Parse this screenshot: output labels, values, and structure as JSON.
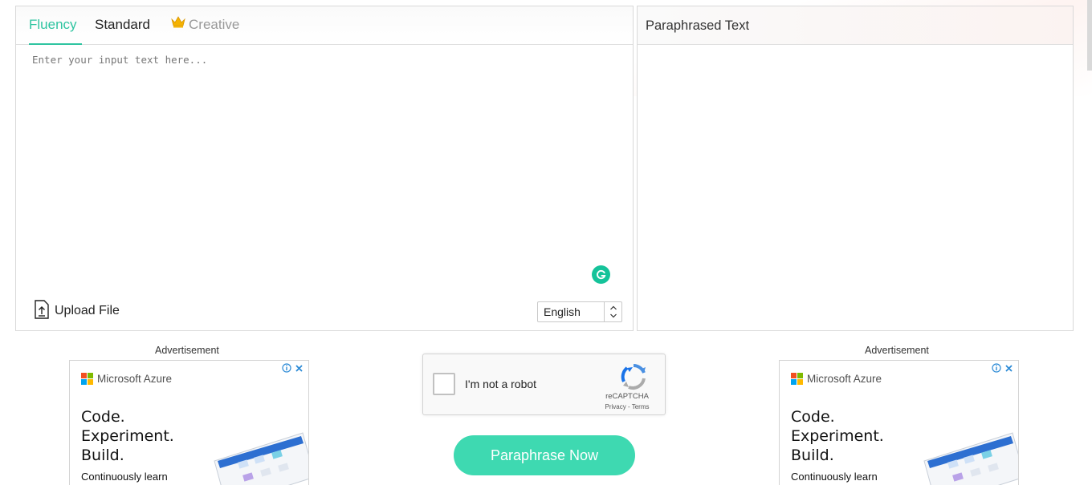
{
  "modes": {
    "tabs": [
      {
        "label": "Fluency",
        "active": true
      },
      {
        "label": "Standard",
        "active": false
      },
      {
        "label": "Creative",
        "active": false,
        "premium": true
      }
    ]
  },
  "input": {
    "placeholder": "Enter your input text here...",
    "value": ""
  },
  "upload": {
    "label": "Upload File",
    "icon": "upload-file-icon"
  },
  "language": {
    "selected": "English"
  },
  "output": {
    "title": "Paraphrased Text"
  },
  "ads": {
    "label": "Advertisement",
    "brand": "Microsoft Azure",
    "headline_lines": [
      "Code.",
      "Experiment.",
      "Build."
    ],
    "subline": "Continuously learn"
  },
  "captcha": {
    "label": "I'm not a robot",
    "brand": "reCAPTCHA",
    "links": "Privacy - Terms"
  },
  "action": {
    "paraphrase_label": "Paraphrase Now"
  },
  "colors": {
    "accent": "#2ec4a0",
    "button": "#3ed9b1",
    "grammarly": "#15c39a",
    "crown": "#f5b301"
  }
}
